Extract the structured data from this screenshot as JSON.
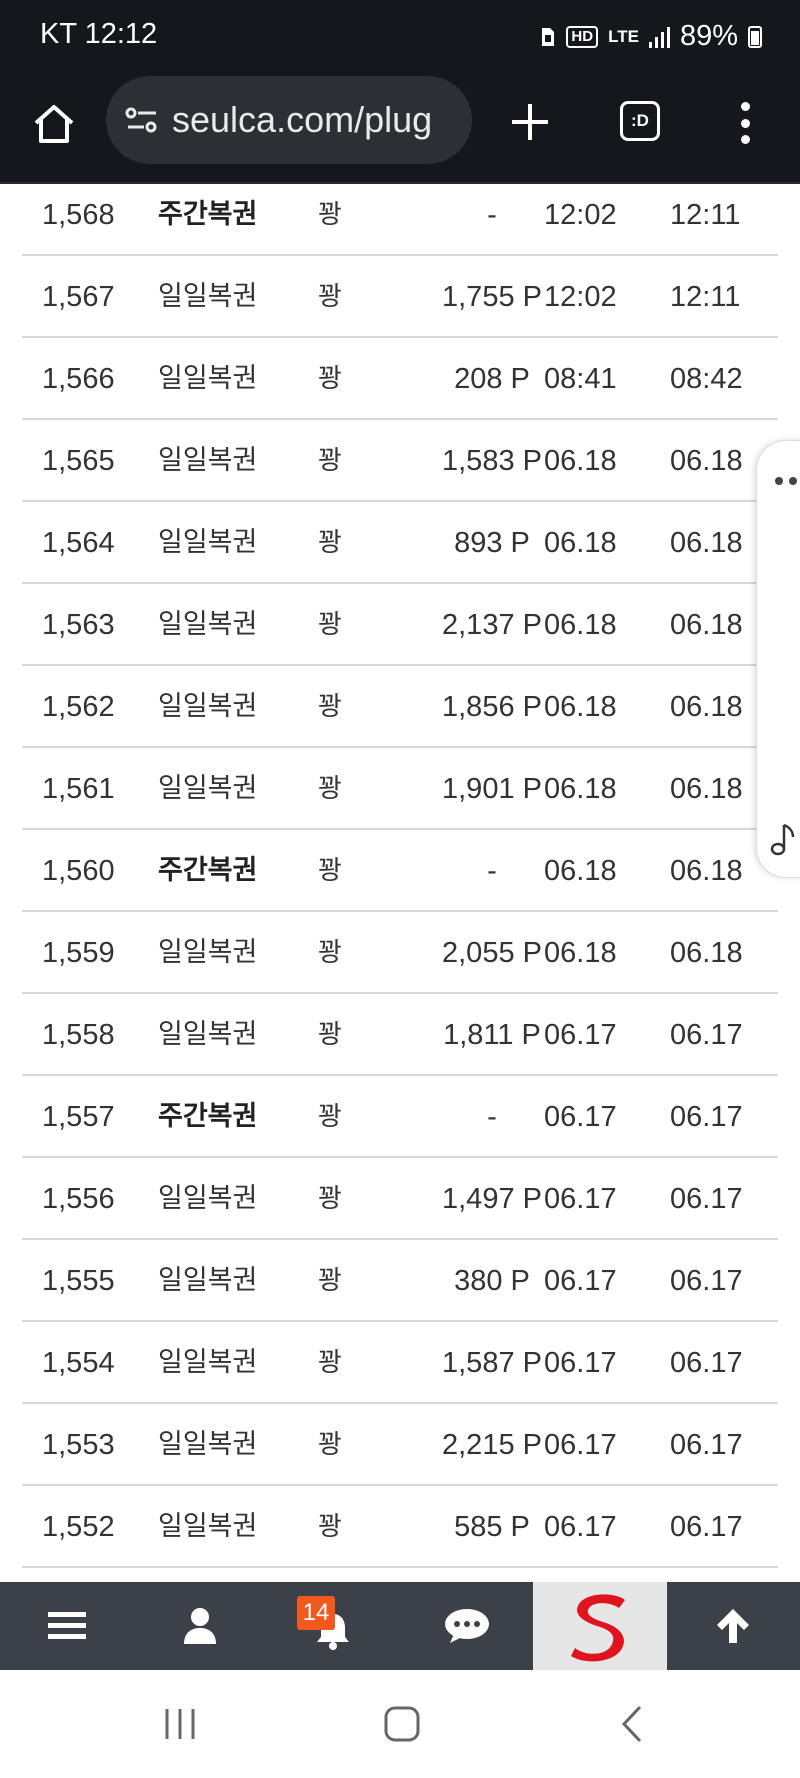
{
  "status_bar": {
    "carrier_time": "KT 12:12",
    "hd_label": "HD",
    "lte_label": "LTE",
    "battery_percent": "89%"
  },
  "browser": {
    "url": "seulca.com/plug",
    "tabs_label": ":D"
  },
  "table": {
    "rows": [
      {
        "no": "1,568",
        "type": "주간복권",
        "bold": true,
        "result": "꽝",
        "point": "-",
        "time1": "12:02",
        "time2": "12:11"
      },
      {
        "no": "1,567",
        "type": "일일복권",
        "bold": false,
        "result": "꽝",
        "point": "1,755 P",
        "time1": "12:02",
        "time2": "12:11"
      },
      {
        "no": "1,566",
        "type": "일일복권",
        "bold": false,
        "result": "꽝",
        "point": "208 P",
        "time1": "08:41",
        "time2": "08:42"
      },
      {
        "no": "1,565",
        "type": "일일복권",
        "bold": false,
        "result": "꽝",
        "point": "1,583 P",
        "time1": "06.18",
        "time2": "06.18"
      },
      {
        "no": "1,564",
        "type": "일일복권",
        "bold": false,
        "result": "꽝",
        "point": "893 P",
        "time1": "06.18",
        "time2": "06.18"
      },
      {
        "no": "1,563",
        "type": "일일복권",
        "bold": false,
        "result": "꽝",
        "point": "2,137 P",
        "time1": "06.18",
        "time2": "06.18"
      },
      {
        "no": "1,562",
        "type": "일일복권",
        "bold": false,
        "result": "꽝",
        "point": "1,856 P",
        "time1": "06.18",
        "time2": "06.18"
      },
      {
        "no": "1,561",
        "type": "일일복권",
        "bold": false,
        "result": "꽝",
        "point": "1,901 P",
        "time1": "06.18",
        "time2": "06.18"
      },
      {
        "no": "1,560",
        "type": "주간복권",
        "bold": true,
        "result": "꽝",
        "point": "-",
        "time1": "06.18",
        "time2": "06.18"
      },
      {
        "no": "1,559",
        "type": "일일복권",
        "bold": false,
        "result": "꽝",
        "point": "2,055 P",
        "time1": "06.18",
        "time2": "06.18"
      },
      {
        "no": "1,558",
        "type": "일일복권",
        "bold": false,
        "result": "꽝",
        "point": "1,811 P",
        "time1": "06.17",
        "time2": "06.17"
      },
      {
        "no": "1,557",
        "type": "주간복권",
        "bold": true,
        "result": "꽝",
        "point": "-",
        "time1": "06.17",
        "time2": "06.17"
      },
      {
        "no": "1,556",
        "type": "일일복권",
        "bold": false,
        "result": "꽝",
        "point": "1,497 P",
        "time1": "06.17",
        "time2": "06.17"
      },
      {
        "no": "1,555",
        "type": "일일복권",
        "bold": false,
        "result": "꽝",
        "point": "380 P",
        "time1": "06.17",
        "time2": "06.17"
      },
      {
        "no": "1,554",
        "type": "일일복권",
        "bold": false,
        "result": "꽝",
        "point": "1,587 P",
        "time1": "06.17",
        "time2": "06.17"
      },
      {
        "no": "1,553",
        "type": "일일복권",
        "bold": false,
        "result": "꽝",
        "point": "2,215 P",
        "time1": "06.17",
        "time2": "06.17"
      },
      {
        "no": "1,552",
        "type": "일일복권",
        "bold": false,
        "result": "꽝",
        "point": "585 P",
        "time1": "06.17",
        "time2": "06.17"
      }
    ]
  },
  "site_nav": {
    "items": [
      {
        "icon": "hamburger-menu-icon"
      },
      {
        "icon": "user-icon"
      },
      {
        "icon": "bell-icon",
        "badge": "14"
      },
      {
        "icon": "chat-bubble-icon"
      },
      {
        "icon": "seulca-logo"
      },
      {
        "icon": "arrow-up-icon"
      }
    ]
  },
  "colors": {
    "dark_bar": "#16171c",
    "url_pill": "#2d2f34",
    "site_nav": "#3c4048",
    "badge": "#f25a1d",
    "logo_red": "#e0141e",
    "row_divider": "#d8d8d8"
  }
}
